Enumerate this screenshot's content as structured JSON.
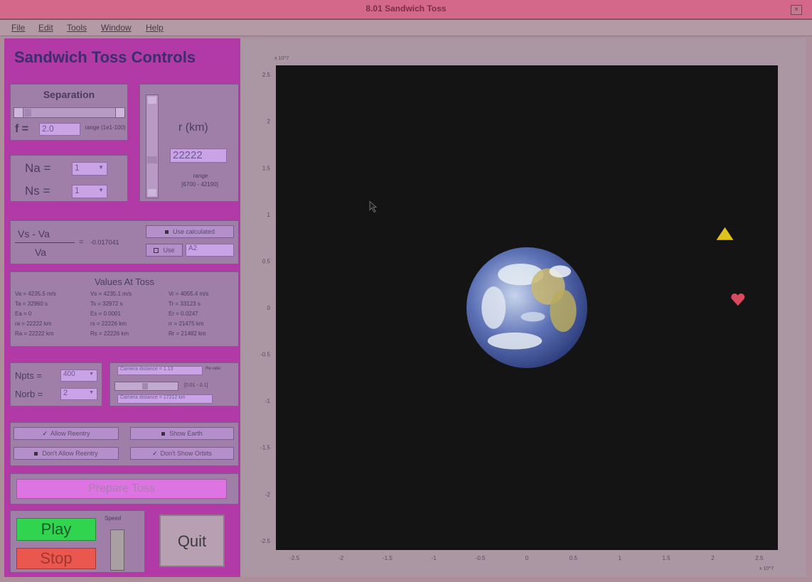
{
  "window": {
    "title": "8.01 Sandwich Toss"
  },
  "menu": [
    "File",
    "Edit",
    "Tools",
    "Window",
    "Help"
  ],
  "controls": {
    "heading": "Sandwich Toss Controls",
    "separation": {
      "label": "Separation",
      "f_label": "f =",
      "f_value": "2.0",
      "range_text": "range (1e1-100)"
    },
    "radius": {
      "label": "r (km)",
      "value": "22222",
      "range_label": "range",
      "range_value": "[6700 - 42190]"
    },
    "na": {
      "label": "Na =",
      "value": "1"
    },
    "ns": {
      "label": "Ns =",
      "value": "1"
    },
    "ratio": {
      "numerator": "Vs - Va",
      "denominator": "Va",
      "equals": "=",
      "value": "-0.017041",
      "option1": "Use calculated",
      "option2_label": "Use",
      "option2_value": "A2"
    },
    "values_at_toss": {
      "title": "Values At Toss",
      "col1": [
        "Va = 4235.5 m/s",
        "Ta = 32960 s",
        "Ea = 0",
        "ra = 22222 km",
        "Ra = 22222 km"
      ],
      "col2": [
        "Vs = 4235.1 m/s",
        "Ts = 32972 s",
        "Es = 0.0001",
        "rs = 22226 km",
        "Rs = 22226 km"
      ],
      "col3": [
        "Vr = 4055.4 m/s",
        "Tr = 33123 s",
        "Er = 0.0247",
        "rr = 21475 km",
        "Rr = 21482 km"
      ]
    },
    "npts": {
      "label": "Npts =",
      "value": "400"
    },
    "norb": {
      "label": "Norb =",
      "value": "2"
    },
    "camera": {
      "distance1": "Camera distance = 1.13",
      "distance1_unit": "Re-ratio",
      "range": "[0.01 - 0.1]",
      "distance2": "Camera distance = 17212 km"
    },
    "toggles": {
      "allow_reentry": "Allow Reentry",
      "dont_allow_reentry": "Don't Allow Reentry",
      "show_earth": "Show Earth",
      "dont_show_orbits": "Don't Show Orbits"
    },
    "prepare": "Prepare Toss",
    "play": "Play",
    "stop": "Stop",
    "speed": "Speed",
    "quit": "Quit"
  },
  "chart_data": {
    "type": "scatter",
    "title": "",
    "xlabel": "",
    "ylabel": "",
    "x_exponent": "x 10^7",
    "y_exponent": "x 10^7",
    "xlim": [
      -2.7,
      2.7
    ],
    "ylim": [
      -2.6,
      2.6
    ],
    "xticks": [
      "-2.5",
      "-2",
      "-1.5",
      "-1",
      "-0.5",
      "0",
      "0.5",
      "1",
      "1.5",
      "2",
      "2.5"
    ],
    "yticks": [
      "2.5",
      "2",
      "1.5",
      "1",
      "0.5",
      "0",
      "-0.5",
      "-1",
      "-1.5",
      "-2",
      "-2.5"
    ],
    "background": "#151415",
    "objects": [
      {
        "name": "Earth",
        "shape": "globe",
        "x": 0,
        "y": 0,
        "radius": 0.65
      },
      {
        "name": "astronaut",
        "shape": "triangle",
        "x": 2.13,
        "y": 0.79,
        "color": "#e0c21c"
      },
      {
        "name": "sandwich",
        "shape": "heart",
        "x": 2.27,
        "y": 0.09,
        "color": "#d94a5e"
      }
    ]
  },
  "colors": {
    "panel": "#b13aa6",
    "titlebar": "#d4688a",
    "play": "#31d44f",
    "stop": "#e9574f",
    "quit": "#b8a0b3",
    "plot_bg": "#151415"
  }
}
